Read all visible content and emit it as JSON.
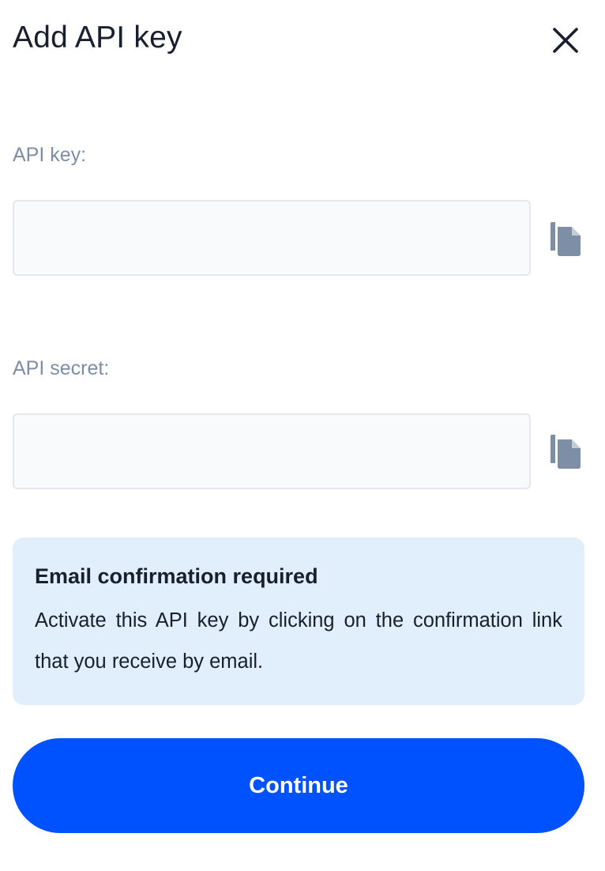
{
  "dialog": {
    "title": "Add API key",
    "close_icon": "close-icon"
  },
  "api_key": {
    "label": "API key:",
    "value": "",
    "copy_icon": "copy-icon"
  },
  "api_secret": {
    "label": "API secret:",
    "value": "",
    "copy_icon": "copy-icon"
  },
  "notice": {
    "title": "Email confirmation required",
    "text": "Activate this API key by clicking on the confirmation link that you receive by email."
  },
  "actions": {
    "continue_label": "Continue"
  },
  "colors": {
    "primary": "#0052ff",
    "notice_bg": "#e0effb",
    "label": "#7d8ea6",
    "icon": "#7d8ea6",
    "text": "#18202e"
  }
}
